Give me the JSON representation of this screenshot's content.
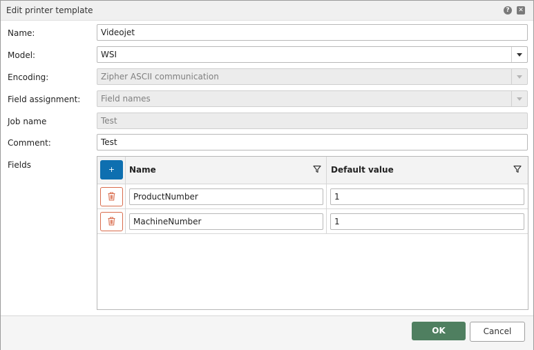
{
  "dialog": {
    "title": "Edit printer template",
    "help_label": "?",
    "close_label": "✕"
  },
  "form": {
    "name": {
      "label": "Name:",
      "value": "Videojet"
    },
    "model": {
      "label": "Model:",
      "value": "WSI"
    },
    "encoding": {
      "label": "Encoding:",
      "value": "Zipher ASCII communication"
    },
    "field_assignment": {
      "label": "Field assignment:",
      "value": "Field names"
    },
    "job_name": {
      "label": "Job name",
      "value": "Test"
    },
    "comment": {
      "label": "Comment:",
      "value": "Test"
    },
    "fields_label": "Fields"
  },
  "fields_grid": {
    "add_label": "+",
    "columns": [
      "Name",
      "Default value"
    ],
    "rows": [
      {
        "name": "ProductNumber",
        "default_value": "1"
      },
      {
        "name": "MachineNumber",
        "default_value": "1"
      }
    ]
  },
  "footer": {
    "ok_label": "OK",
    "cancel_label": "Cancel"
  },
  "colors": {
    "accent_blue": "#0e6fb0",
    "ok_green": "#4f7f60",
    "delete_red": "#d86a4a"
  },
  "icons": {
    "help": "help-icon",
    "close": "close-icon",
    "filter": "filter-icon",
    "delete": "trash-icon",
    "dropdown": "chevron-down-icon"
  }
}
